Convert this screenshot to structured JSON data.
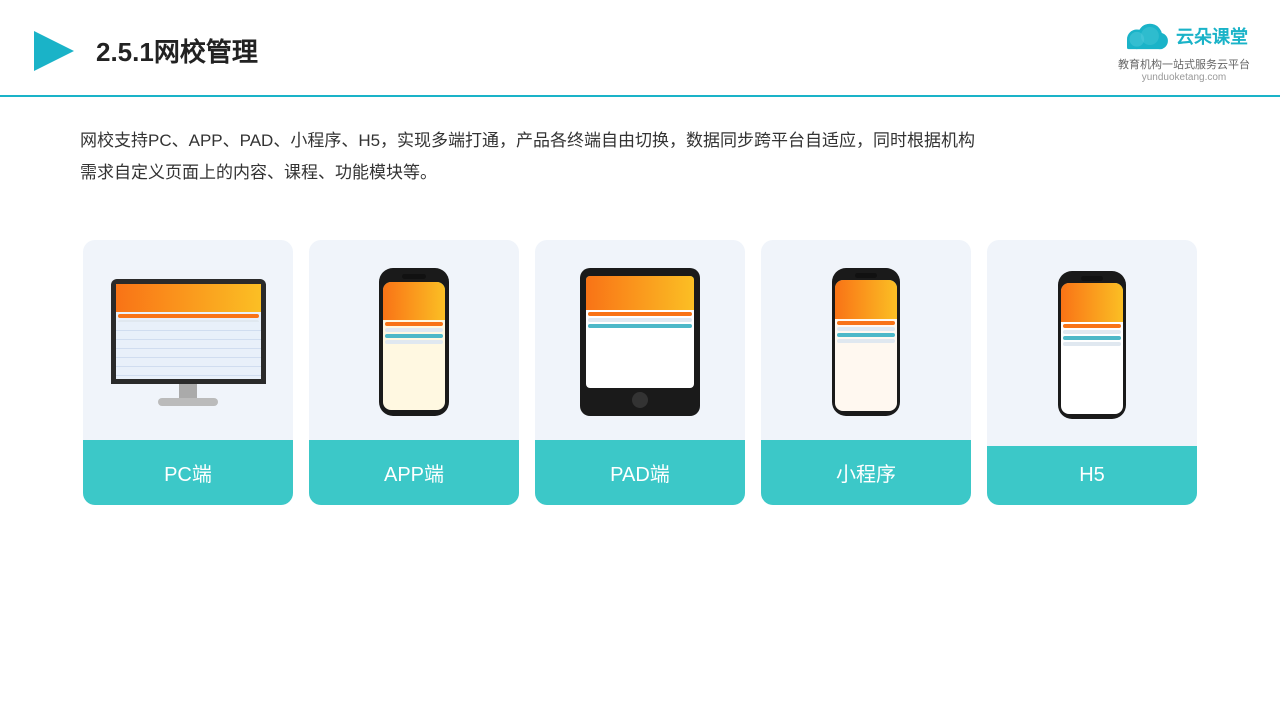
{
  "header": {
    "title": "2.5.1网校管理",
    "logo_brand": "云朵课堂",
    "logo_domain": "yunduoketang.com",
    "logo_tagline": "教育机构一站\n式服务云平台"
  },
  "description": {
    "text": "网校支持PC、APP、PAD、小程序、H5，实现多端打通，产品各终端自由切换，数据同步跨平台自适应，同时根据机构需求自定义页面上的内容、课程、功能模块等。"
  },
  "cards": [
    {
      "id": "pc",
      "label": "PC端"
    },
    {
      "id": "app",
      "label": "APP端"
    },
    {
      "id": "pad",
      "label": "PAD端"
    },
    {
      "id": "miniprogram",
      "label": "小程序"
    },
    {
      "id": "h5",
      "label": "H5"
    }
  ]
}
